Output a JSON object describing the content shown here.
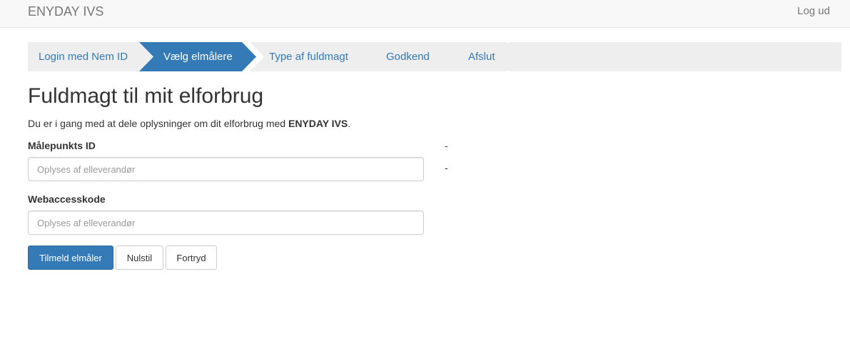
{
  "navbar": {
    "brand": "ENYDAY IVS",
    "logout": "Log ud"
  },
  "wizard": {
    "steps": [
      {
        "label": "Login med Nem ID"
      },
      {
        "label": "Vælg elmålere",
        "active": true
      },
      {
        "label": "Type af fuldmagt"
      },
      {
        "label": "Godkend"
      },
      {
        "label": "Afslut"
      }
    ],
    "colors": {
      "active": "#337ab7",
      "inactive": "#eeeeee",
      "link": "#337ab7"
    }
  },
  "page": {
    "title": "Fuldmagt til mit elforbrug",
    "intro_prefix": "Du er i gang med at dele oplysninger om dit elforbrug med ",
    "intro_company": "ENYDAY IVS",
    "intro_suffix": "."
  },
  "form": {
    "meter_id": {
      "label": "Målepunkts ID",
      "placeholder": "Oplyses af elleverandør",
      "value": ""
    },
    "webaccess": {
      "label": "Webaccesskode",
      "placeholder": "Oplyses af elleverandør",
      "value": ""
    },
    "side_values": [
      "-",
      "-"
    ]
  },
  "buttons": {
    "submit": "Tilmeld elmåler",
    "reset": "Nulstil",
    "cancel": "Fortryd"
  }
}
